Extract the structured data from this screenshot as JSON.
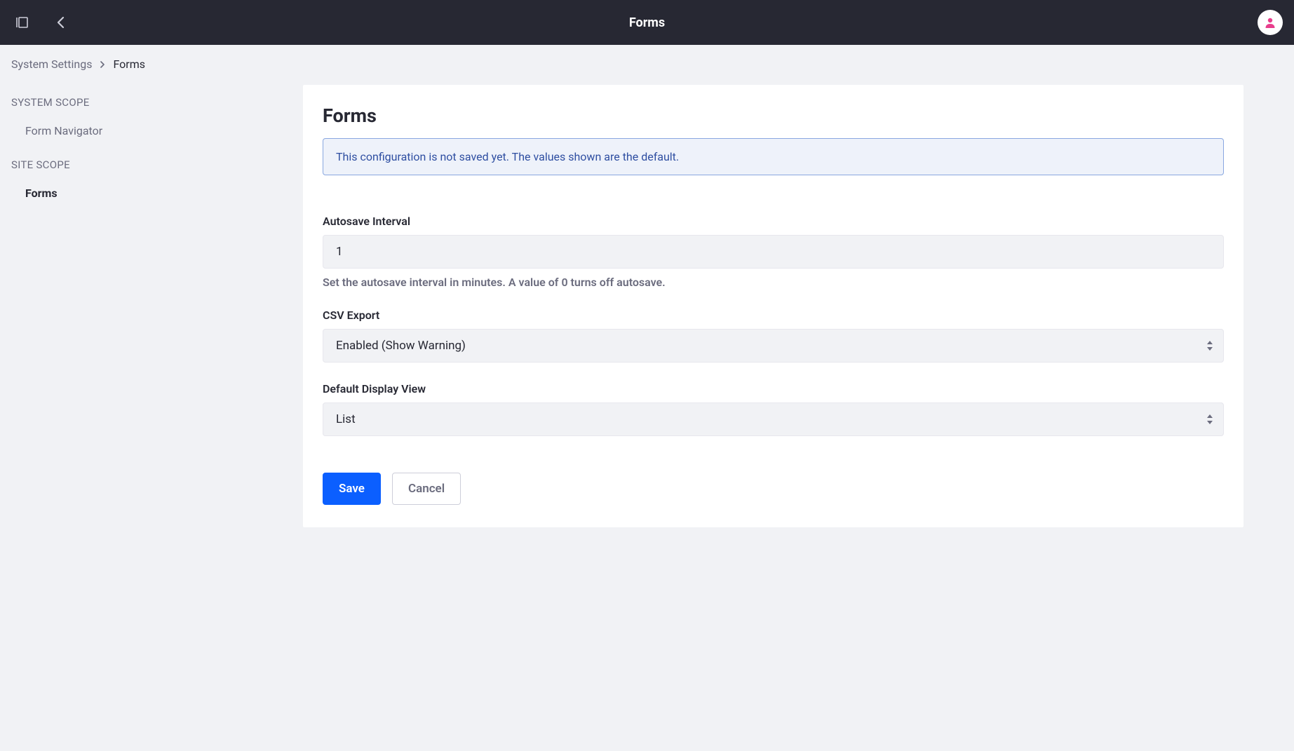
{
  "header": {
    "title": "Forms"
  },
  "breadcrumb": {
    "parent": "System Settings",
    "current": "Forms"
  },
  "sidebar": {
    "system_scope_label": "System Scope",
    "site_scope_label": "Site Scope",
    "items": {
      "form_navigator": "Form Navigator",
      "forms": "Forms"
    }
  },
  "panel": {
    "title": "Forms",
    "info_message": "This configuration is not saved yet. The values shown are the default.",
    "autosave": {
      "label": "Autosave Interval",
      "value": "1",
      "help": "Set the autosave interval in minutes. A value of 0 turns off autosave."
    },
    "csv_export": {
      "label": "CSV Export",
      "value": "Enabled (Show Warning)"
    },
    "default_display_view": {
      "label": "Default Display View",
      "value": "List"
    },
    "actions": {
      "save": "Save",
      "cancel": "Cancel"
    }
  }
}
